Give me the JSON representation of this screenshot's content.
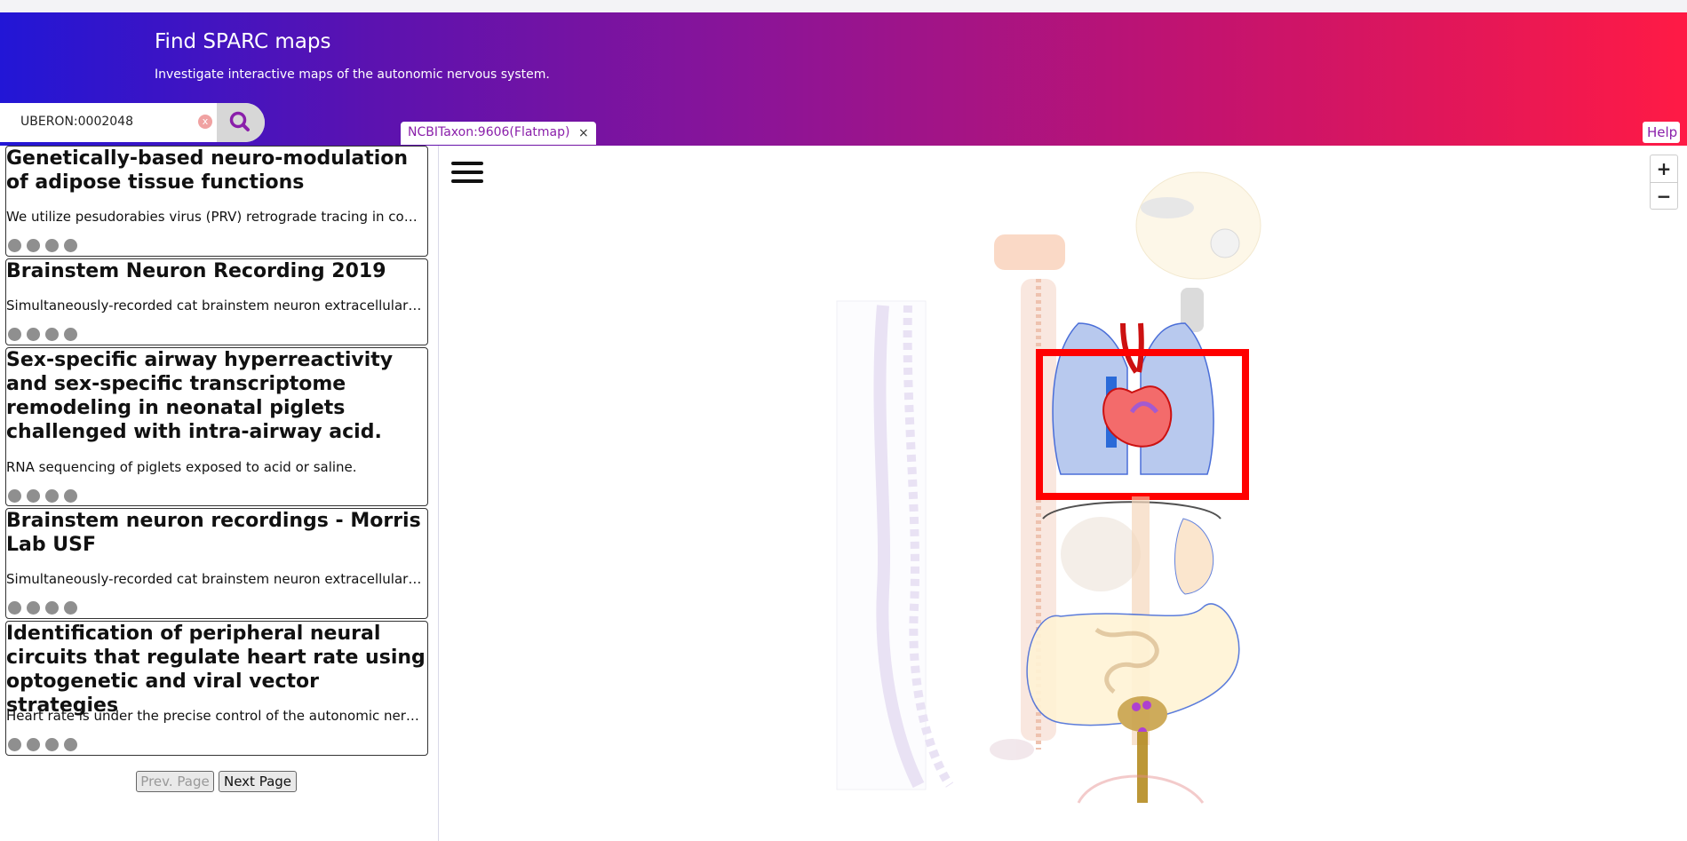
{
  "header": {
    "title": "Find SPARC maps",
    "subtitle": "Investigate interactive maps of the autonomic nervous system."
  },
  "search": {
    "value": "UBERON:0002048",
    "clear_icon": "x",
    "search_icon": "magnifier"
  },
  "tabs": [
    {
      "label": "NCBITaxon:9606(Flatmap)",
      "close": "×"
    }
  ],
  "help_label": "Help",
  "results": [
    {
      "title": "Genetically-based neuro-modulation of adipose tissue functions",
      "description": "We utilize pesudorabies virus (PRV) retrograde tracing in combination with neural recordings to study adipose tissue innervation"
    },
    {
      "title": "Brainstem Neuron Recording 2019",
      "description": "Simultaneously-recorded cat brainstem neuron extracellular potentials"
    },
    {
      "title": "Sex-specific airway hyperreactivity and sex-specific transcriptome remodeling in neonatal piglets challenged with intra-airway acid.",
      "description": "RNA sequencing of piglets exposed to acid or saline."
    },
    {
      "title": "Brainstem neuron recordings - Morris Lab USF",
      "description": "Simultaneously-recorded cat brainstem neuron extracellular potentials"
    },
    {
      "title": "Identification of peripheral neural circuits that regulate heart rate using optogenetic and viral vector strategies",
      "description": "Heart rate is under the precise control of the autonomic nervous system"
    }
  ],
  "pagination": {
    "prev": "Prev. Page",
    "next": "Next Page"
  },
  "map": {
    "zoom_in": "+",
    "zoom_out": "−",
    "menu_icon": "hamburger-menu",
    "highlight_color": "#ff0000"
  },
  "colors": {
    "gradient_start": "#2216d6",
    "gradient_end": "#ff1a45",
    "tab_text": "#8a1faa"
  }
}
